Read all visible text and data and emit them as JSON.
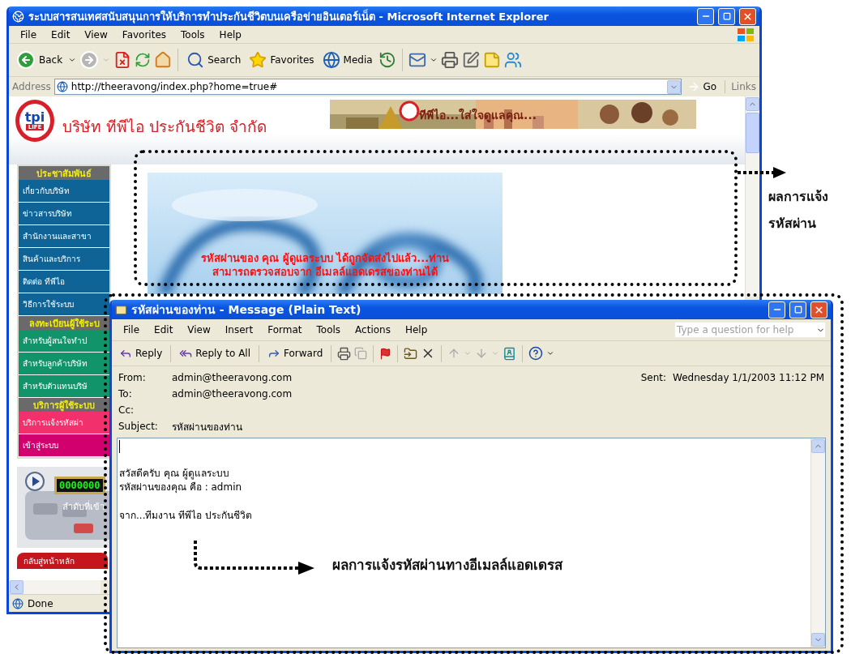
{
  "browser_window": {
    "title": "ระบบสารสนเทศสนับสนุนการให้บริการทำประกันชีวิตบนเครือข่ายอินเตอร์เน็ต - Microsoft Internet Explorer",
    "menu": [
      "File",
      "Edit",
      "View",
      "Favorites",
      "Tools",
      "Help"
    ],
    "toolbar": [
      "Back",
      "Search",
      "Favorites",
      "Media"
    ],
    "address": {
      "label": "Address",
      "value": "http://theeravong/index.php?home=true#",
      "go": "Go",
      "links": "Links"
    },
    "page": {
      "logo": {
        "mark": "tpi",
        "ribbon": "LIFE"
      },
      "company": "บริษัท ทีพีไอ ประกันชีวิต จำกัด",
      "slogan": "ทีพีไอ...ใส่ใจดูแลคุณ...",
      "sidebar": [
        {
          "heading": "ประชาสัมพันธ์",
          "items": [
            {
              "label": "เกี่ยวกับบริษัท",
              "color": "#0e6496"
            },
            {
              "label": "ข่าวสารบริษัท",
              "color": "#0e6496"
            },
            {
              "label": "สำนักงานและสาขา",
              "color": "#0e6496"
            },
            {
              "label": "สินค้าและบริการ",
              "color": "#0e6496"
            },
            {
              "label": "ติดต่อ ทีพีไอ",
              "color": "#0e6496"
            },
            {
              "label": "วิธีการใช้ระบบ",
              "color": "#0e6496"
            }
          ]
        },
        {
          "heading": "ลงทะเบียนผู้ใช้ระบ",
          "items": [
            {
              "label": "สำหรับผู้สนใจทำป",
              "color": "#12946a"
            },
            {
              "label": "สำหรับลูกค้าบริษัท",
              "color": "#12946a"
            },
            {
              "label": "สำหรับตัวแทนบริษั",
              "color": "#12946a"
            }
          ]
        },
        {
          "heading": "บริการผู้ใช้ระบบ",
          "items": [
            {
              "label": "บริการแจ้งรหัสผ่า",
              "color": "#f2306c"
            },
            {
              "label": "เข้าสู่ระบบ",
              "color": "#d2006e"
            }
          ]
        }
      ],
      "counter": "0000000",
      "counter_caption": "ลำดับที่เข้า",
      "home_button": "กลับสู่หน้าหลัก",
      "notice": "รหัสผ่านของ คุณ ผู้ดูแลระบบ ได้ถูกจัดส่งไปแล้ว...ท่าน\nสามารถตรวจสอบจาก อีเมลล์แอดเดรสของท่านได้"
    },
    "status_bar": "Done"
  },
  "message_window": {
    "title": "รหัสผ่านของท่าน - Message (Plain Text)",
    "menu": [
      "File",
      "Edit",
      "View",
      "Insert",
      "Format",
      "Tools",
      "Actions",
      "Help"
    ],
    "help_search": {
      "placeholder": "Type a question for help"
    },
    "toolbar": [
      "Reply",
      "Reply to All",
      "Forward"
    ],
    "fields": [
      {
        "label": "From:",
        "value": "admin@theeravong.com"
      },
      {
        "label": "To:",
        "value": "admin@theeravong.com"
      },
      {
        "label": "Cc:"
      },
      {
        "label": "Subject:",
        "value": "รหัสผ่านของท่าน"
      }
    ],
    "sent": {
      "label": "Sent:",
      "value": "Wednesday 1/1/2003 11:12 PM"
    },
    "body": [
      "สวัสดีครับ คุณ ผู้ดูแลระบบ\nรหัสผ่านของคุณ  คือ : admin",
      "จาก...ทีมงาน ทีพีไอ ประกันชีวิต"
    ]
  },
  "annotations": [
    "ผลการแจ้ง\nรหัสผ่าน",
    "ผลการแจ้งรหัสผ่านทางอีเมลล์แอดเดรส"
  ]
}
